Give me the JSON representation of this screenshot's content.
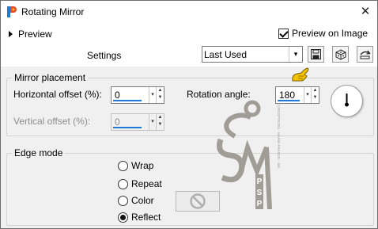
{
  "window": {
    "title": "Rotating Mirror",
    "close_glyph": "✕"
  },
  "toolbar": {
    "preview_label": "Preview",
    "preview_on_image_label": "Preview on Image",
    "preview_on_image_checked": true,
    "settings_label": "Settings",
    "preset_value": "Last Used",
    "preset_arrow": "▾",
    "save_icon": "save-icon",
    "randomize_icon": "dice-icon",
    "reset_icon": "reset-icon"
  },
  "mirror_placement": {
    "title": "Mirror placement",
    "horizontal_offset_label": "Horizontal offset (%):",
    "horizontal_offset_value": "0",
    "vertical_offset_label": "Vertical offset (%):",
    "vertical_offset_value": "0",
    "vertical_offset_enabled": false,
    "rotation_angle_label": "Rotation angle:",
    "rotation_angle_value": "180",
    "spin_up": "▲",
    "spin_down": "▼",
    "spin_drop": "▾"
  },
  "edge_mode": {
    "title": "Edge mode",
    "options": [
      {
        "label": "Wrap",
        "selected": false
      },
      {
        "label": "Repeat",
        "selected": false
      },
      {
        "label": "Color",
        "selected": false
      },
      {
        "label": "Reflect",
        "selected": true
      }
    ]
  },
  "watermark": {
    "letters": "SM",
    "vertical_text": "PSP",
    "vertical_small_text": "CONCEPTIONS · MARIE-FRANCE · SM"
  },
  "colors": {
    "accent_underline": "#1c79d8",
    "hand_cursor": "#f5c400",
    "watermark": "#a09c96"
  }
}
